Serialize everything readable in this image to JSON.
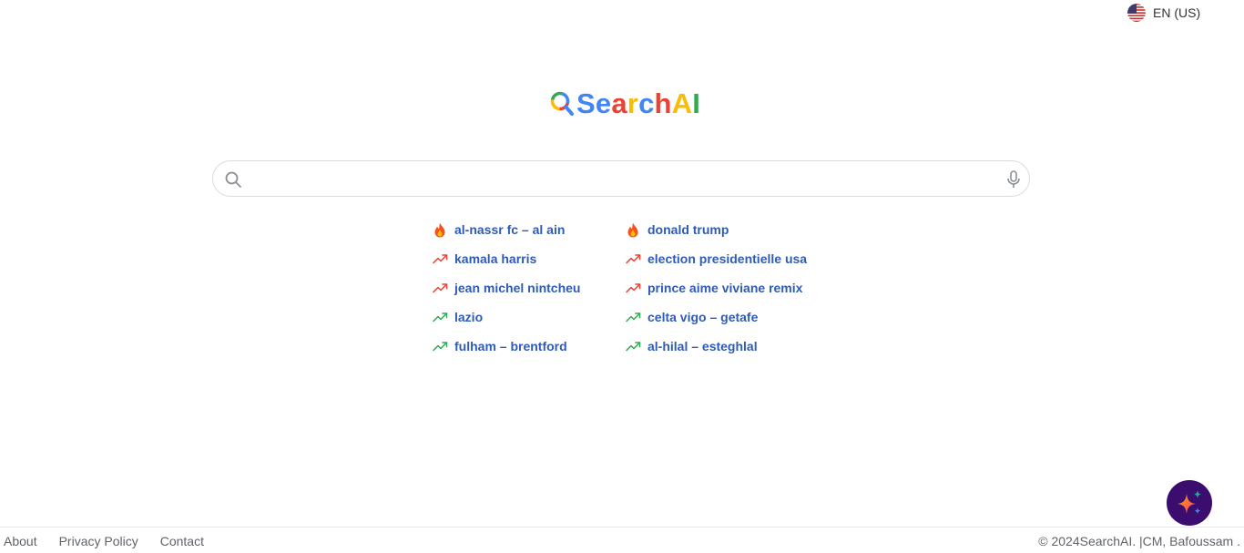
{
  "language": {
    "label": "EN (US)",
    "flag_icon": "us-flag-icon"
  },
  "logo": {
    "letters": [
      "S",
      "e",
      "a",
      "r",
      "c",
      "h",
      "A",
      "I"
    ],
    "colors": [
      "#4285F4",
      "#4285F4",
      "#EA4335",
      "#FBBC05",
      "#4285F4",
      "#EA4335",
      "#FBBC05",
      "#34A853"
    ],
    "icon": "magnifier-logo-icon"
  },
  "search": {
    "value": "",
    "placeholder": "",
    "search_icon": "search-icon",
    "mic_icon": "microphone-icon"
  },
  "trends": {
    "left": [
      {
        "label": "al-nassr fc – al ain",
        "icon": "fire-icon"
      },
      {
        "label": "kamala harris",
        "icon": "trending-up-red-icon"
      },
      {
        "label": "jean michel nintcheu",
        "icon": "trending-up-red-icon"
      },
      {
        "label": "lazio",
        "icon": "trending-up-green-icon"
      },
      {
        "label": "fulham – brentford",
        "icon": "trending-up-green-icon"
      }
    ],
    "right": [
      {
        "label": "donald trump",
        "icon": "fire-icon"
      },
      {
        "label": "election presidentielle usa",
        "icon": "trending-up-red-icon"
      },
      {
        "label": "prince aime viviane remix",
        "icon": "trending-up-red-icon"
      },
      {
        "label": "celta vigo – getafe",
        "icon": "trending-up-green-icon"
      },
      {
        "label": "al-hilal – esteghlal",
        "icon": "trending-up-green-icon"
      }
    ]
  },
  "fab": {
    "icon": "sparkles-icon"
  },
  "footer": {
    "about": "About",
    "privacy": "Privacy Policy",
    "contact": "Contact",
    "copyright": "© 2024SearchAI. |CM,  Bafoussam  ."
  },
  "colors": {
    "trend_link": "#2f5bb7",
    "trend_red": "#ea4335",
    "trend_green": "#34a853",
    "fab_bg": "#3a0d6e"
  }
}
